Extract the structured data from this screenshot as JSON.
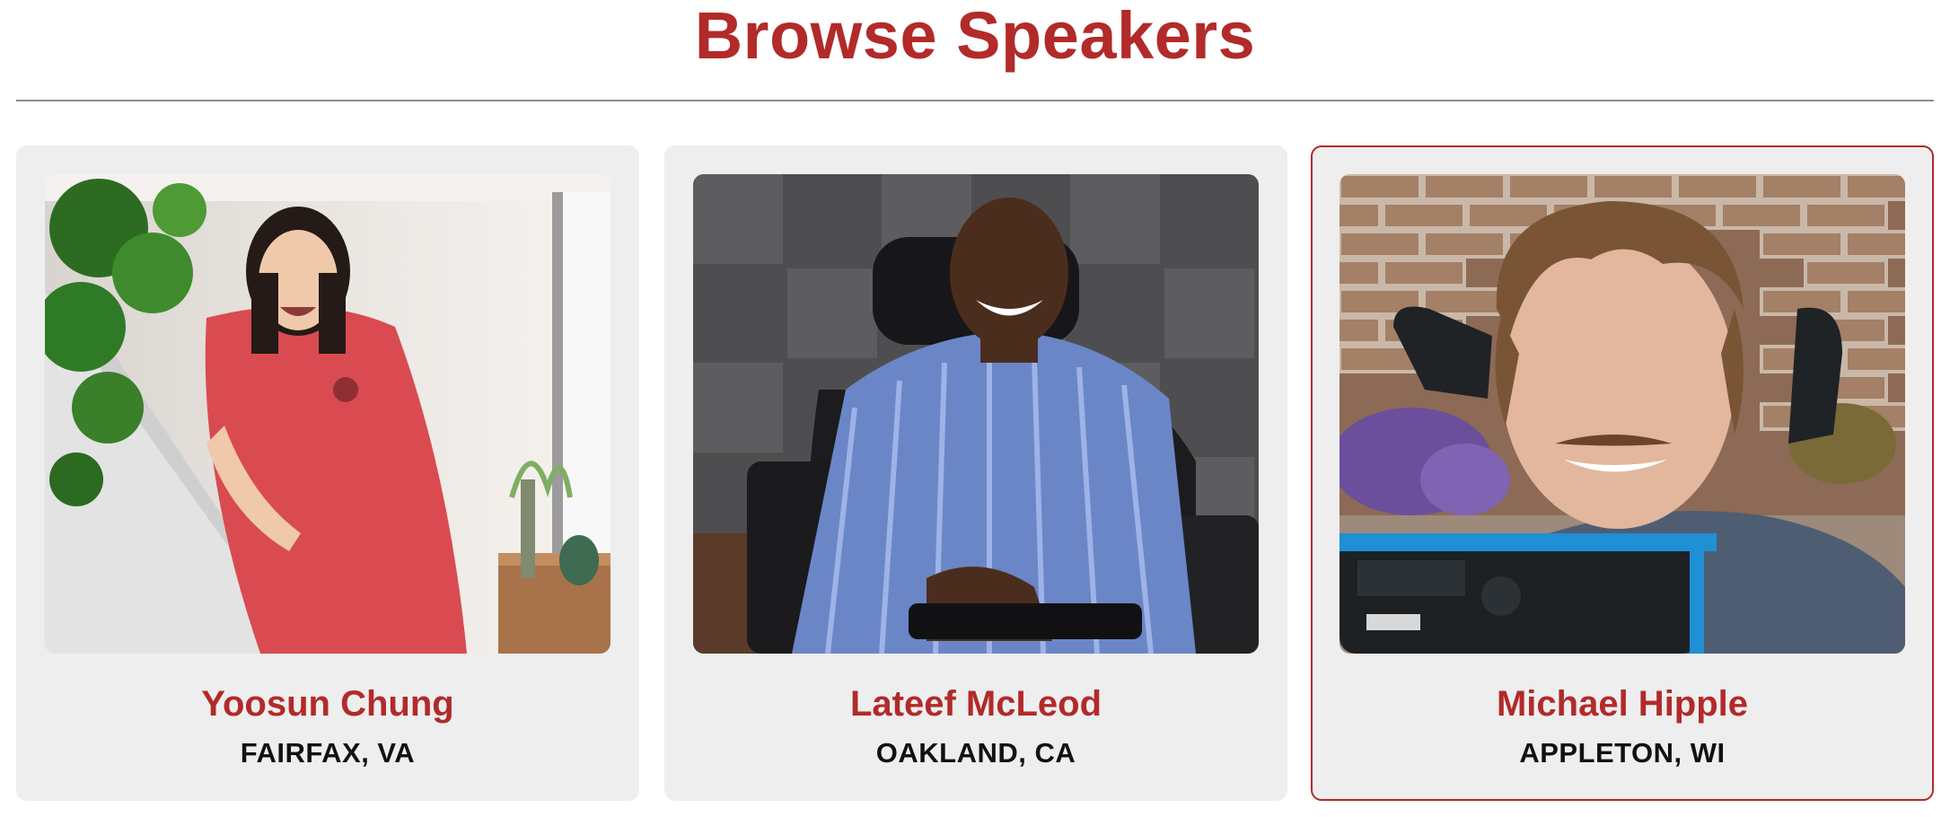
{
  "page": {
    "title": "Browse Speakers"
  },
  "colors": {
    "accent": "#b22a2a",
    "card_background": "#eeeeee",
    "divider": "#8c8c8c"
  },
  "speakers": [
    {
      "name": "Yoosun Chung",
      "location": "FAIRFAX, VA",
      "selected": false
    },
    {
      "name": "Lateef McLeod",
      "location": "OAKLAND, CA",
      "selected": false
    },
    {
      "name": "Michael Hipple",
      "location": "APPLETON, WI",
      "selected": true
    }
  ]
}
